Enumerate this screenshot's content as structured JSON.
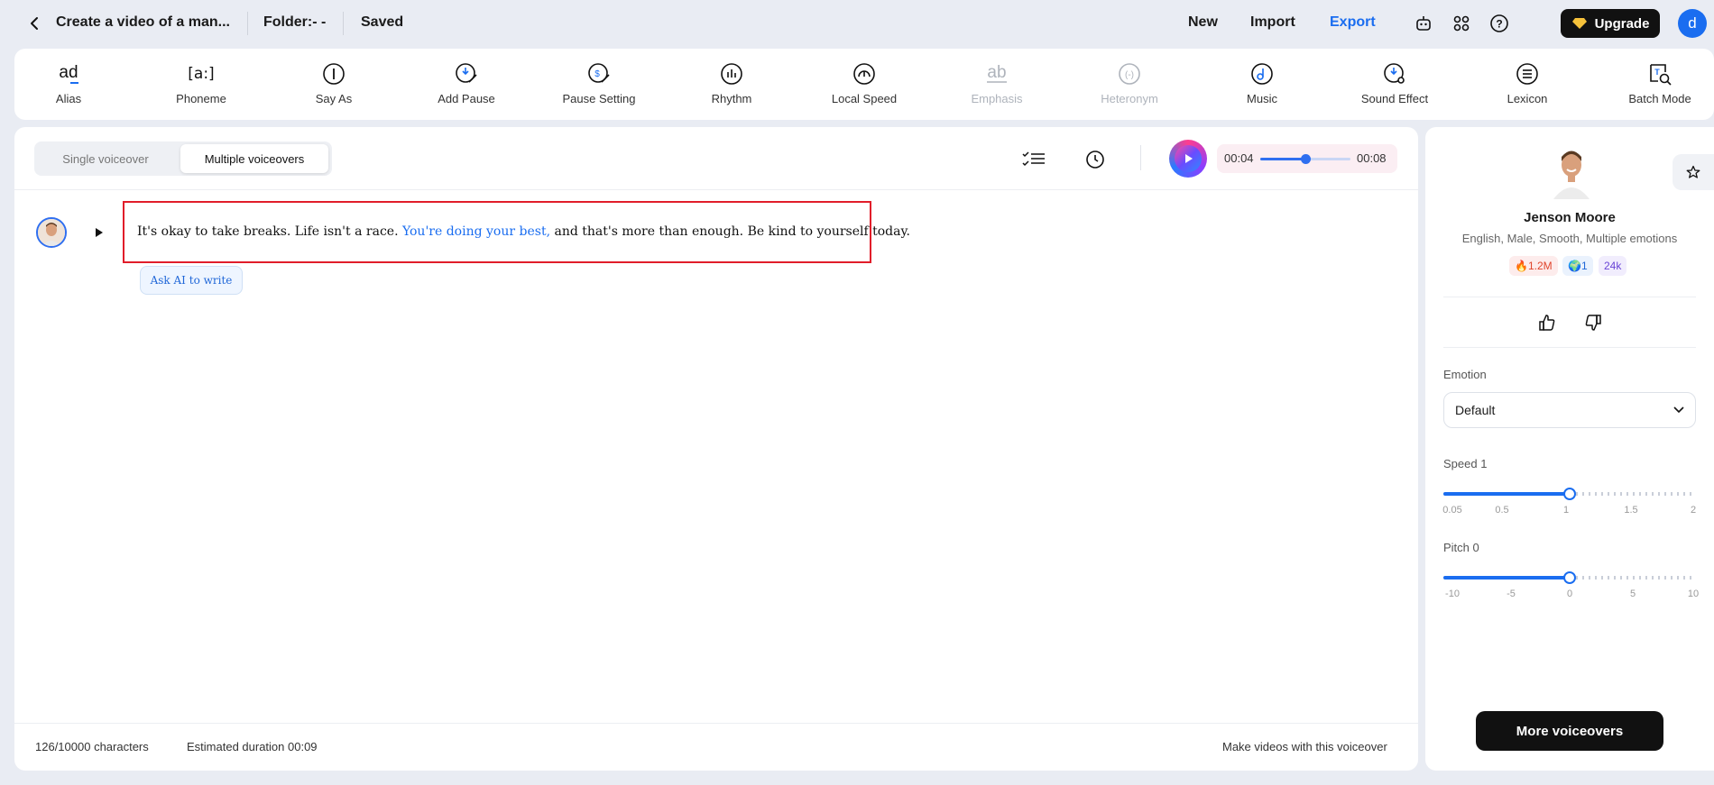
{
  "header": {
    "project_title": "Create a video of a man...",
    "folder": "Folder:- -",
    "saved": "Saved",
    "new_label": "New",
    "import_label": "Import",
    "export_label": "Export",
    "upgrade_label": "Upgrade",
    "avatar_letter": "d",
    "accent_color": "#1a6df0"
  },
  "toolbar": {
    "items": [
      {
        "label": "Alias",
        "icon": "alias-icon"
      },
      {
        "label": "Phoneme",
        "icon": "phoneme-icon"
      },
      {
        "label": "Say As",
        "icon": "say-as-icon"
      },
      {
        "label": "Add Pause",
        "icon": "add-pause-icon"
      },
      {
        "label": "Pause Setting",
        "icon": "pause-setting-icon"
      },
      {
        "label": "Rhythm",
        "icon": "rhythm-icon"
      },
      {
        "label": "Local Speed",
        "icon": "local-speed-icon"
      },
      {
        "label": "Emphasis",
        "icon": "emphasis-icon",
        "disabled": true
      },
      {
        "label": "Heteronym",
        "icon": "heteronym-icon",
        "disabled": true
      },
      {
        "label": "Music",
        "icon": "music-icon"
      },
      {
        "label": "Sound Effect",
        "icon": "sound-effect-icon"
      },
      {
        "label": "Lexicon",
        "icon": "lexicon-icon"
      },
      {
        "label": "Batch Mode",
        "icon": "batch-mode-icon"
      }
    ]
  },
  "editor": {
    "toggle": {
      "single": "Single voiceover",
      "multiple": "Multiple voiceovers",
      "selected": "multiple"
    },
    "player": {
      "current": "00:04",
      "total": "00:08",
      "progress": 0.5
    },
    "paragraph": {
      "before": "It's okay to take breaks. Life isn't a race. ",
      "highlight": "You're doing your best,",
      "after": " and that's more than enough. Be kind to yourself today."
    },
    "ask_ai": "Ask AI to write",
    "footer": {
      "characters": "126/10000 characters",
      "duration": "Estimated duration 00:09",
      "make_videos": "Make videos with this voiceover"
    }
  },
  "voice": {
    "name": "Jenson Moore",
    "description": "English, Male, Smooth, Multiple emotions",
    "badges": {
      "hot": "1.2M",
      "globe": "1",
      "count": "24k"
    },
    "emotion_label": "Emotion",
    "emotion_value": "Default",
    "speed_label": "Speed 1",
    "speed_ticks": [
      "0.05",
      "0.5",
      "1",
      "1.5",
      "2"
    ],
    "speed_value": 1,
    "pitch_label": "Pitch 0",
    "pitch_ticks": [
      "-10",
      "-5",
      "0",
      "5",
      "10"
    ],
    "pitch_value": 0,
    "more_button": "More voiceovers"
  }
}
